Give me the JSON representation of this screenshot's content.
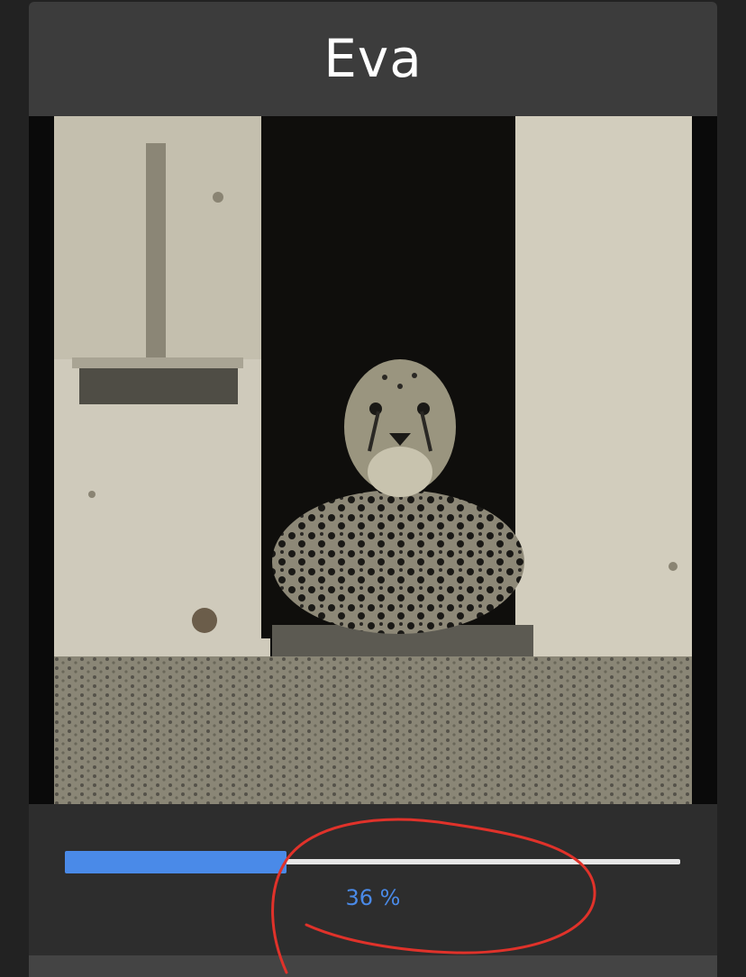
{
  "header": {
    "title": "Eva"
  },
  "photo": {
    "description_icon": "cheetah-photo"
  },
  "progress": {
    "value_fraction": 0.36,
    "label": "36 %",
    "fill_color": "#4a8ae8",
    "track_color": "#e6e6e6"
  },
  "annotation": {
    "stroke_color": "#e0322a"
  }
}
